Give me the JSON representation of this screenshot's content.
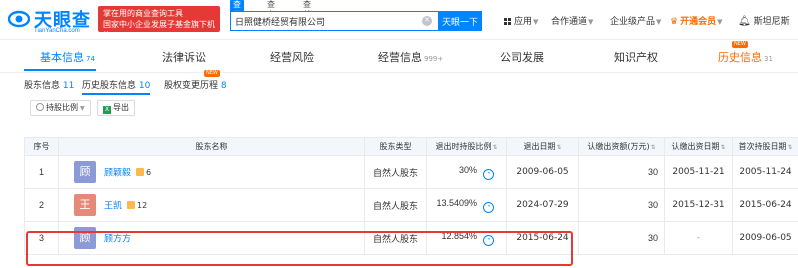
{
  "header": {
    "logo_text": "天眼查",
    "logo_domain": "TianYanCha.com",
    "promo_line1": "掌在用的商业查询工具",
    "promo_line2": "国家中小企业发展子基金旗下机构",
    "search_tabs": [
      "查公司",
      "查老板",
      "查关系"
    ],
    "search_value": "日照健桥经贸有限公司",
    "search_button": "天眼一下",
    "nav_apps": "应用",
    "nav_channel": "合作通道",
    "nav_enterprise": "企业级产品",
    "nav_vip": "开通会员",
    "nav_user": "斯坦尼斯",
    "colors": {
      "brand": "#0084ff",
      "vip": "#ff6a00",
      "promo": "#e53935"
    }
  },
  "tabs": [
    {
      "label": "基本信息",
      "count": "74"
    },
    {
      "label": "法律诉讼",
      "count": ""
    },
    {
      "label": "经营风险",
      "count": ""
    },
    {
      "label": "经营信息",
      "count": "999+"
    },
    {
      "label": "公司发展",
      "count": ""
    },
    {
      "label": "知识产权",
      "count": ""
    },
    {
      "label": "历史信息",
      "count": "31"
    }
  ],
  "subtabs": [
    {
      "label": "股东信息",
      "count": "11"
    },
    {
      "label": "历史股东信息",
      "count": "10"
    },
    {
      "label": "股权变更历程",
      "count": "8"
    }
  ],
  "tools": {
    "filter_label": "持股比例",
    "export_label": "导出"
  },
  "table": {
    "headers": [
      "序号",
      "股东名称",
      "股东类型",
      "退出时持股比例",
      "退出日期",
      "认缴出资额(万元)",
      "认缴出资日期",
      "首次持股日期"
    ],
    "rows": [
      {
        "idx": "1",
        "avatar": "顾",
        "avatar_color": "#8c9ad6",
        "name": "顾颖毅",
        "badge": "6",
        "type": "自然人股东",
        "ratio": "30%",
        "exit_date": "2009-06-05",
        "amount": "30",
        "sub_date": "2005-11-21",
        "first_date": "2005-11-24"
      },
      {
        "idx": "2",
        "avatar": "王",
        "avatar_color": "#e58a79",
        "name": "王凯",
        "badge": "12",
        "type": "自然人股东",
        "ratio": "13.5409%",
        "exit_date": "2024-07-29",
        "amount": "30",
        "sub_date": "2015-12-31",
        "first_date": "2015-06-24"
      },
      {
        "idx": "3",
        "avatar": "顾",
        "avatar_color": "#8c9ad6",
        "name": "顾方方",
        "badge": "",
        "type": "自然人股东",
        "ratio": "12.854%",
        "exit_date": "2015-06-24",
        "amount": "30",
        "sub_date": "-",
        "first_date": "2009-06-05"
      }
    ]
  }
}
